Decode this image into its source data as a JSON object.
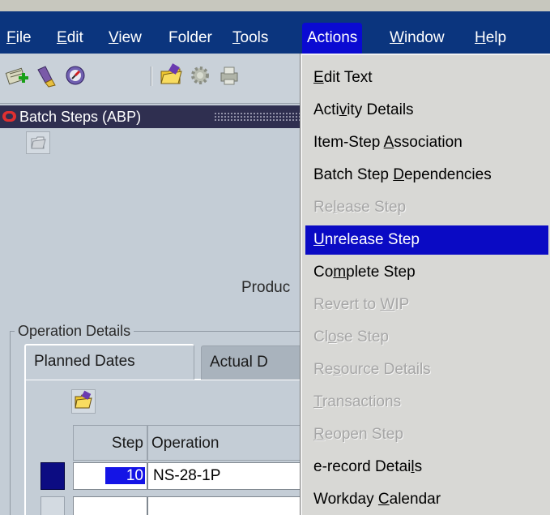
{
  "menubar": {
    "items": [
      {
        "pre": "",
        "mn": "F",
        "post": "ile"
      },
      {
        "pre": "",
        "mn": "E",
        "post": "dit"
      },
      {
        "pre": "",
        "mn": "V",
        "post": "iew"
      },
      {
        "pre": "Folder",
        "mn": "",
        "post": ""
      },
      {
        "pre": "",
        "mn": "T",
        "post": "ools"
      },
      {
        "pre": "Actions",
        "mn": "",
        "post": ""
      },
      {
        "pre": "",
        "mn": "W",
        "post": "indow"
      },
      {
        "pre": "",
        "mn": "H",
        "post": "elp"
      }
    ],
    "active": "Actions"
  },
  "toolbar": {
    "icons": [
      "new-record-icon",
      "flashlight-icon",
      "navigator-icon",
      "save-folder-icon",
      "gear-icon",
      "print-icon"
    ]
  },
  "window": {
    "title": "Batch Steps (ABP)"
  },
  "form": {
    "prod_label": "Produc",
    "operation_details_legend": "Operation Details",
    "tabs": [
      "Planned Dates",
      "Actual D"
    ],
    "table": {
      "columns": [
        "Step",
        "Operation"
      ],
      "rows": [
        {
          "step": "10",
          "operation": "NS-28-1P"
        }
      ]
    }
  },
  "actions_menu": {
    "items": [
      {
        "pre": "",
        "mn": "E",
        "post": "dit Text",
        "state": "enabled"
      },
      {
        "pre": "Acti",
        "mn": "v",
        "post": "ity Details",
        "state": "enabled"
      },
      {
        "pre": "Item-Step ",
        "mn": "A",
        "post": "ssociation",
        "state": "enabled"
      },
      {
        "pre": "Batch Step ",
        "mn": "D",
        "post": "ependencies",
        "state": "enabled"
      },
      {
        "pre": "Re",
        "mn": "l",
        "post": "ease Step",
        "state": "disabled"
      },
      {
        "pre": "",
        "mn": "U",
        "post": "nrelease Step",
        "state": "highlighted"
      },
      {
        "pre": "Co",
        "mn": "m",
        "post": "plete Step",
        "state": "enabled"
      },
      {
        "pre": "Revert to ",
        "mn": "W",
        "post": "IP",
        "state": "disabled"
      },
      {
        "pre": "Cl",
        "mn": "o",
        "post": "se Step",
        "state": "disabled"
      },
      {
        "pre": "Re",
        "mn": "s",
        "post": "ource Details",
        "state": "disabled"
      },
      {
        "pre": "",
        "mn": "T",
        "post": "ransactions",
        "state": "disabled"
      },
      {
        "pre": "",
        "mn": "R",
        "post": "eopen Step",
        "state": "disabled"
      },
      {
        "pre": "e-record Detai",
        "mn": "l",
        "post": "s",
        "state": "enabled"
      },
      {
        "pre": "Workday ",
        "mn": "C",
        "post": "alendar",
        "state": "enabled"
      }
    ]
  },
  "colors": {
    "menubar": "#0b357e",
    "highlight": "#0a0ac4",
    "titlebar": "#2f2f50",
    "form_bg": "#c4cdd6",
    "menu_bg": "#d8d8d5"
  }
}
